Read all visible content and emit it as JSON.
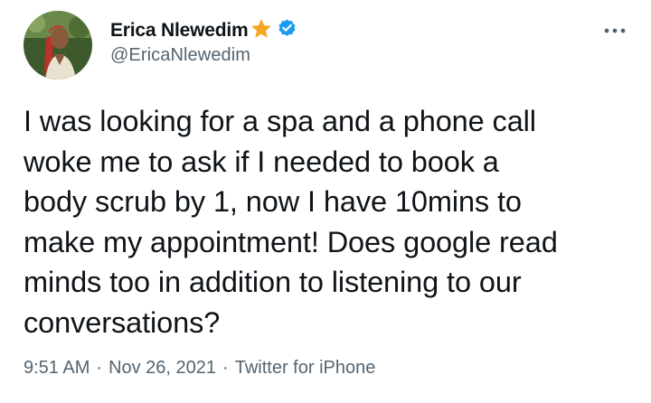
{
  "author": {
    "display_name": "Erica Nlewedim",
    "handle": "@EricaNlewedim",
    "avatar": "profile-photo",
    "badges": [
      "star-icon",
      "verified-icon"
    ]
  },
  "tweet": {
    "text": "I was looking for a spa and a phone call\nwoke me to ask if I needed to book a\nbody scrub by 1, now I have 10mins to\nmake my appointment! Does google read\nminds too in addition to listening to our\nconversations?",
    "time": "9:51 AM",
    "separator": "·",
    "date": "Nov 26, 2021",
    "source": "Twitter for iPhone"
  },
  "colors": {
    "text": "#0f1419",
    "secondary": "#536471",
    "verified": "#1d9bf0",
    "star": "#f5a623"
  }
}
